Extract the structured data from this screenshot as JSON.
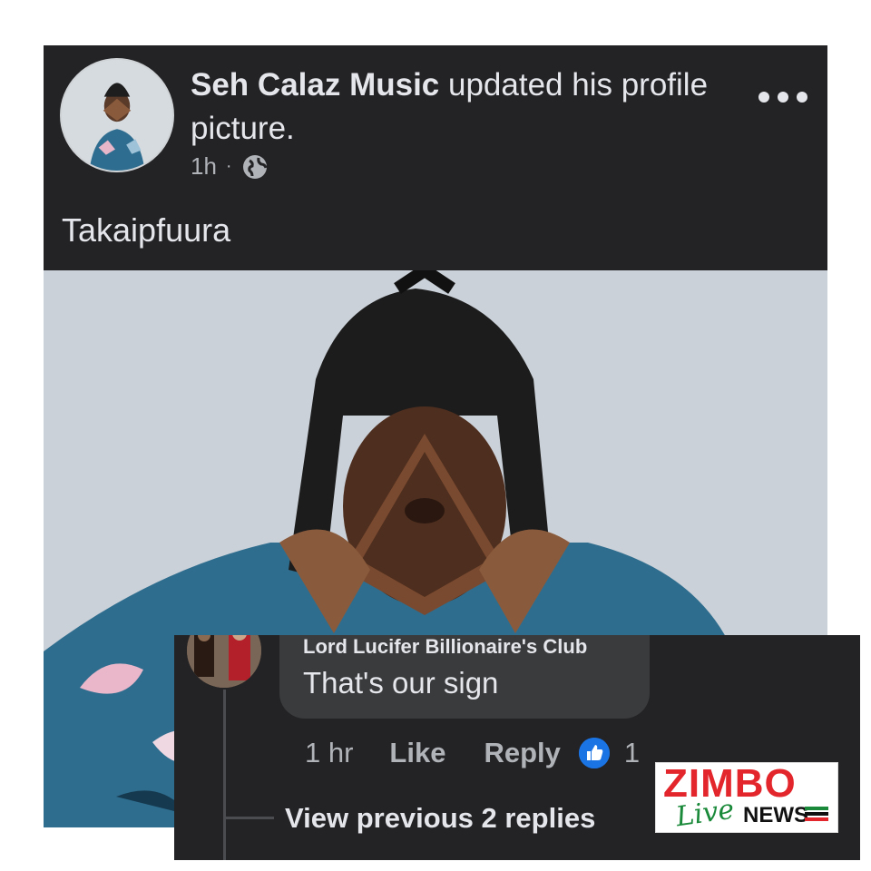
{
  "post": {
    "author": "Seh Calaz Music",
    "action_text": "updated his profile picture.",
    "time": "1h",
    "separator": "·",
    "privacy_icon": "globe-icon",
    "more_icon": "more-options-icon",
    "caption": "Takaipfuura"
  },
  "comment": {
    "author": "Lord Lucifer Billionaire's Club",
    "text": "That's our sign",
    "time": "1 hr",
    "like_label": "Like",
    "reply_label": "Reply",
    "reaction_icon": "like-reaction-icon",
    "reaction_count": "1",
    "view_replies_label": "View previous 2 replies"
  },
  "watermark": {
    "brand_top": "ZIMBO",
    "brand_live": "Live",
    "brand_news": "NEWS",
    "colors": {
      "red": "#e3262b",
      "green": "#1a8a3a",
      "black": "#111111"
    }
  },
  "colors": {
    "card_bg": "#232325",
    "text_primary": "#e4e6eb",
    "text_secondary": "#b0b3b8",
    "bubble_bg": "#3a3b3c",
    "like_blue": "#1b74e4"
  }
}
